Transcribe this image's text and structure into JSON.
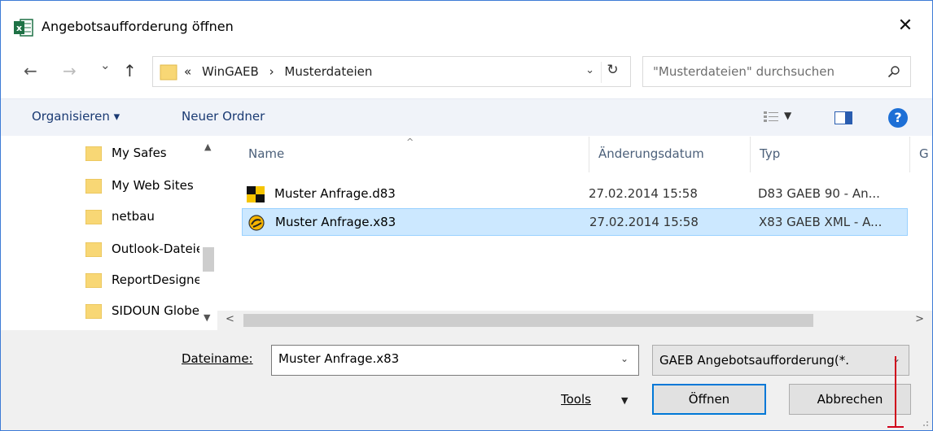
{
  "window": {
    "title": "Angebotsaufforderung öffnen",
    "close_glyph": "✕"
  },
  "nav": {
    "back": "←",
    "forward": "→",
    "recent": "⌄",
    "up": "↑"
  },
  "address": {
    "overflow": "«",
    "crumbs": [
      "WinGAEB",
      "›",
      "Musterdateien"
    ],
    "dropdown": "⌄",
    "refresh": "↻"
  },
  "search": {
    "placeholder": "\"Musterdateien\" durchsuchen"
  },
  "toolbar": {
    "organize": "Organisieren ▾",
    "new_folder": "Neuer Ordner",
    "view_dropdown": "▼",
    "help": "?"
  },
  "sidebar": {
    "items": [
      {
        "label": "My Safes"
      },
      {
        "label": "My Web Sites"
      },
      {
        "label": "netbau"
      },
      {
        "label": "Outlook-Dateien"
      },
      {
        "label": "ReportDesigner"
      },
      {
        "label": "SIDOUN Globe"
      }
    ]
  },
  "filelist": {
    "columns": {
      "name": "Name",
      "date": "Änderungsdatum",
      "type": "Typ",
      "size": "G"
    },
    "sort_indicator": "^",
    "rows": [
      {
        "name": "Muster Anfrage.d83",
        "date": "27.02.2014 15:58",
        "type": "D83 GAEB 90 - An...",
        "selected": false
      },
      {
        "name": "Muster Anfrage.x83",
        "date": "27.02.2014 15:58",
        "type": "X83 GAEB XML - A...",
        "selected": true
      }
    ],
    "scroll_left": "<",
    "scroll_right": ">"
  },
  "bottom": {
    "filename_label": "Dateiname:",
    "filename_value": "Muster Anfrage.x83",
    "filter_value": "GAEB Angebotsaufforderung(*.",
    "tools_label": "Tools",
    "open_label": "Öffnen",
    "cancel_label": "Abbrechen"
  },
  "colors": {
    "accent": "#0078d7",
    "selection": "#cce8ff",
    "annotation": "#d0021b"
  }
}
